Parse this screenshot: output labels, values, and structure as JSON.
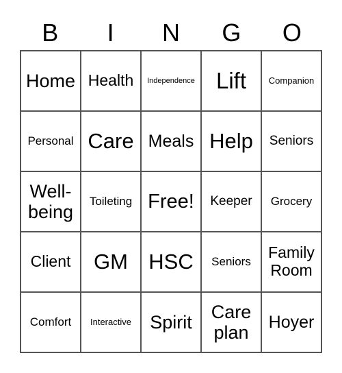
{
  "header": [
    "B",
    "I",
    "N",
    "G",
    "O"
  ],
  "cells": [
    [
      "Home",
      "Health",
      "Independence",
      "Lift",
      "Companion"
    ],
    [
      "Personal",
      "Care",
      "Meals",
      "Help",
      "Seniors"
    ],
    [
      "Well-being",
      "Toileting",
      "Free!",
      "Keeper",
      "Grocery"
    ],
    [
      "Client",
      "GM",
      "HSC",
      "Seniors",
      "Family Room"
    ],
    [
      "Comfort",
      "Interactive",
      "Spirit",
      "Care plan",
      "Hoyer"
    ]
  ]
}
